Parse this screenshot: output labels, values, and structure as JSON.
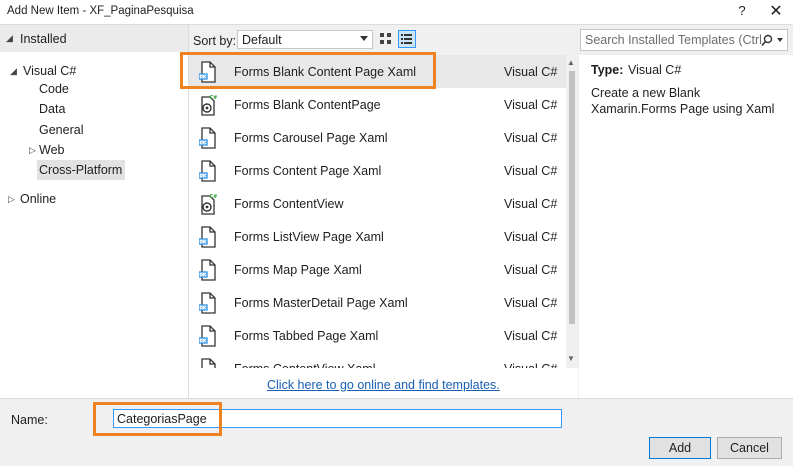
{
  "window": {
    "title": "Add New Item - XF_PaginaPesquisa",
    "help": "?",
    "close": "✕"
  },
  "tree": {
    "installed": "Installed",
    "visual_csharp": "Visual C#",
    "children": [
      "Code",
      "Data",
      "General",
      "Web",
      "Cross-Platform"
    ],
    "online": "Online"
  },
  "toolbar": {
    "sort_label": "Sort by:",
    "sort_value": "Default"
  },
  "search": {
    "placeholder": "Search Installed Templates (Ctrl+E)"
  },
  "templates": [
    {
      "name": "Forms Blank Content Page Xaml",
      "lang": "Visual C#",
      "icon": "xaml-page-icon"
    },
    {
      "name": "Forms Blank ContentPage",
      "lang": "Visual C#",
      "icon": "csharp-page-icon"
    },
    {
      "name": "Forms Carousel Page Xaml",
      "lang": "Visual C#",
      "icon": "xaml-page-icon"
    },
    {
      "name": "Forms Content Page Xaml",
      "lang": "Visual C#",
      "icon": "xaml-page-icon"
    },
    {
      "name": "Forms ContentView",
      "lang": "Visual C#",
      "icon": "csharp-page-icon"
    },
    {
      "name": "Forms ListView Page Xaml",
      "lang": "Visual C#",
      "icon": "xaml-page-icon"
    },
    {
      "name": "Forms Map Page Xaml",
      "lang": "Visual C#",
      "icon": "xaml-page-icon"
    },
    {
      "name": "Forms MasterDetail Page Xaml",
      "lang": "Visual C#",
      "icon": "xaml-page-icon"
    },
    {
      "name": "Forms Tabbed Page Xaml",
      "lang": "Visual C#",
      "icon": "xaml-page-icon"
    },
    {
      "name": "Forms ContentView Xaml",
      "lang": "Visual C#",
      "icon": "xaml-page-icon"
    }
  ],
  "online_link": "Click here to go online and find templates.",
  "details": {
    "type_label": "Type:",
    "type_value": "Visual C#",
    "description": "Create a new Blank Xamarin.Forms Page using Xaml"
  },
  "name_field": {
    "label": "Name:",
    "value": "CategoriasPage"
  },
  "buttons": {
    "add": "Add",
    "cancel": "Cancel"
  },
  "colors": {
    "highlight": "#f08321",
    "link": "#1a5fb4",
    "accent": "#0078d7"
  }
}
